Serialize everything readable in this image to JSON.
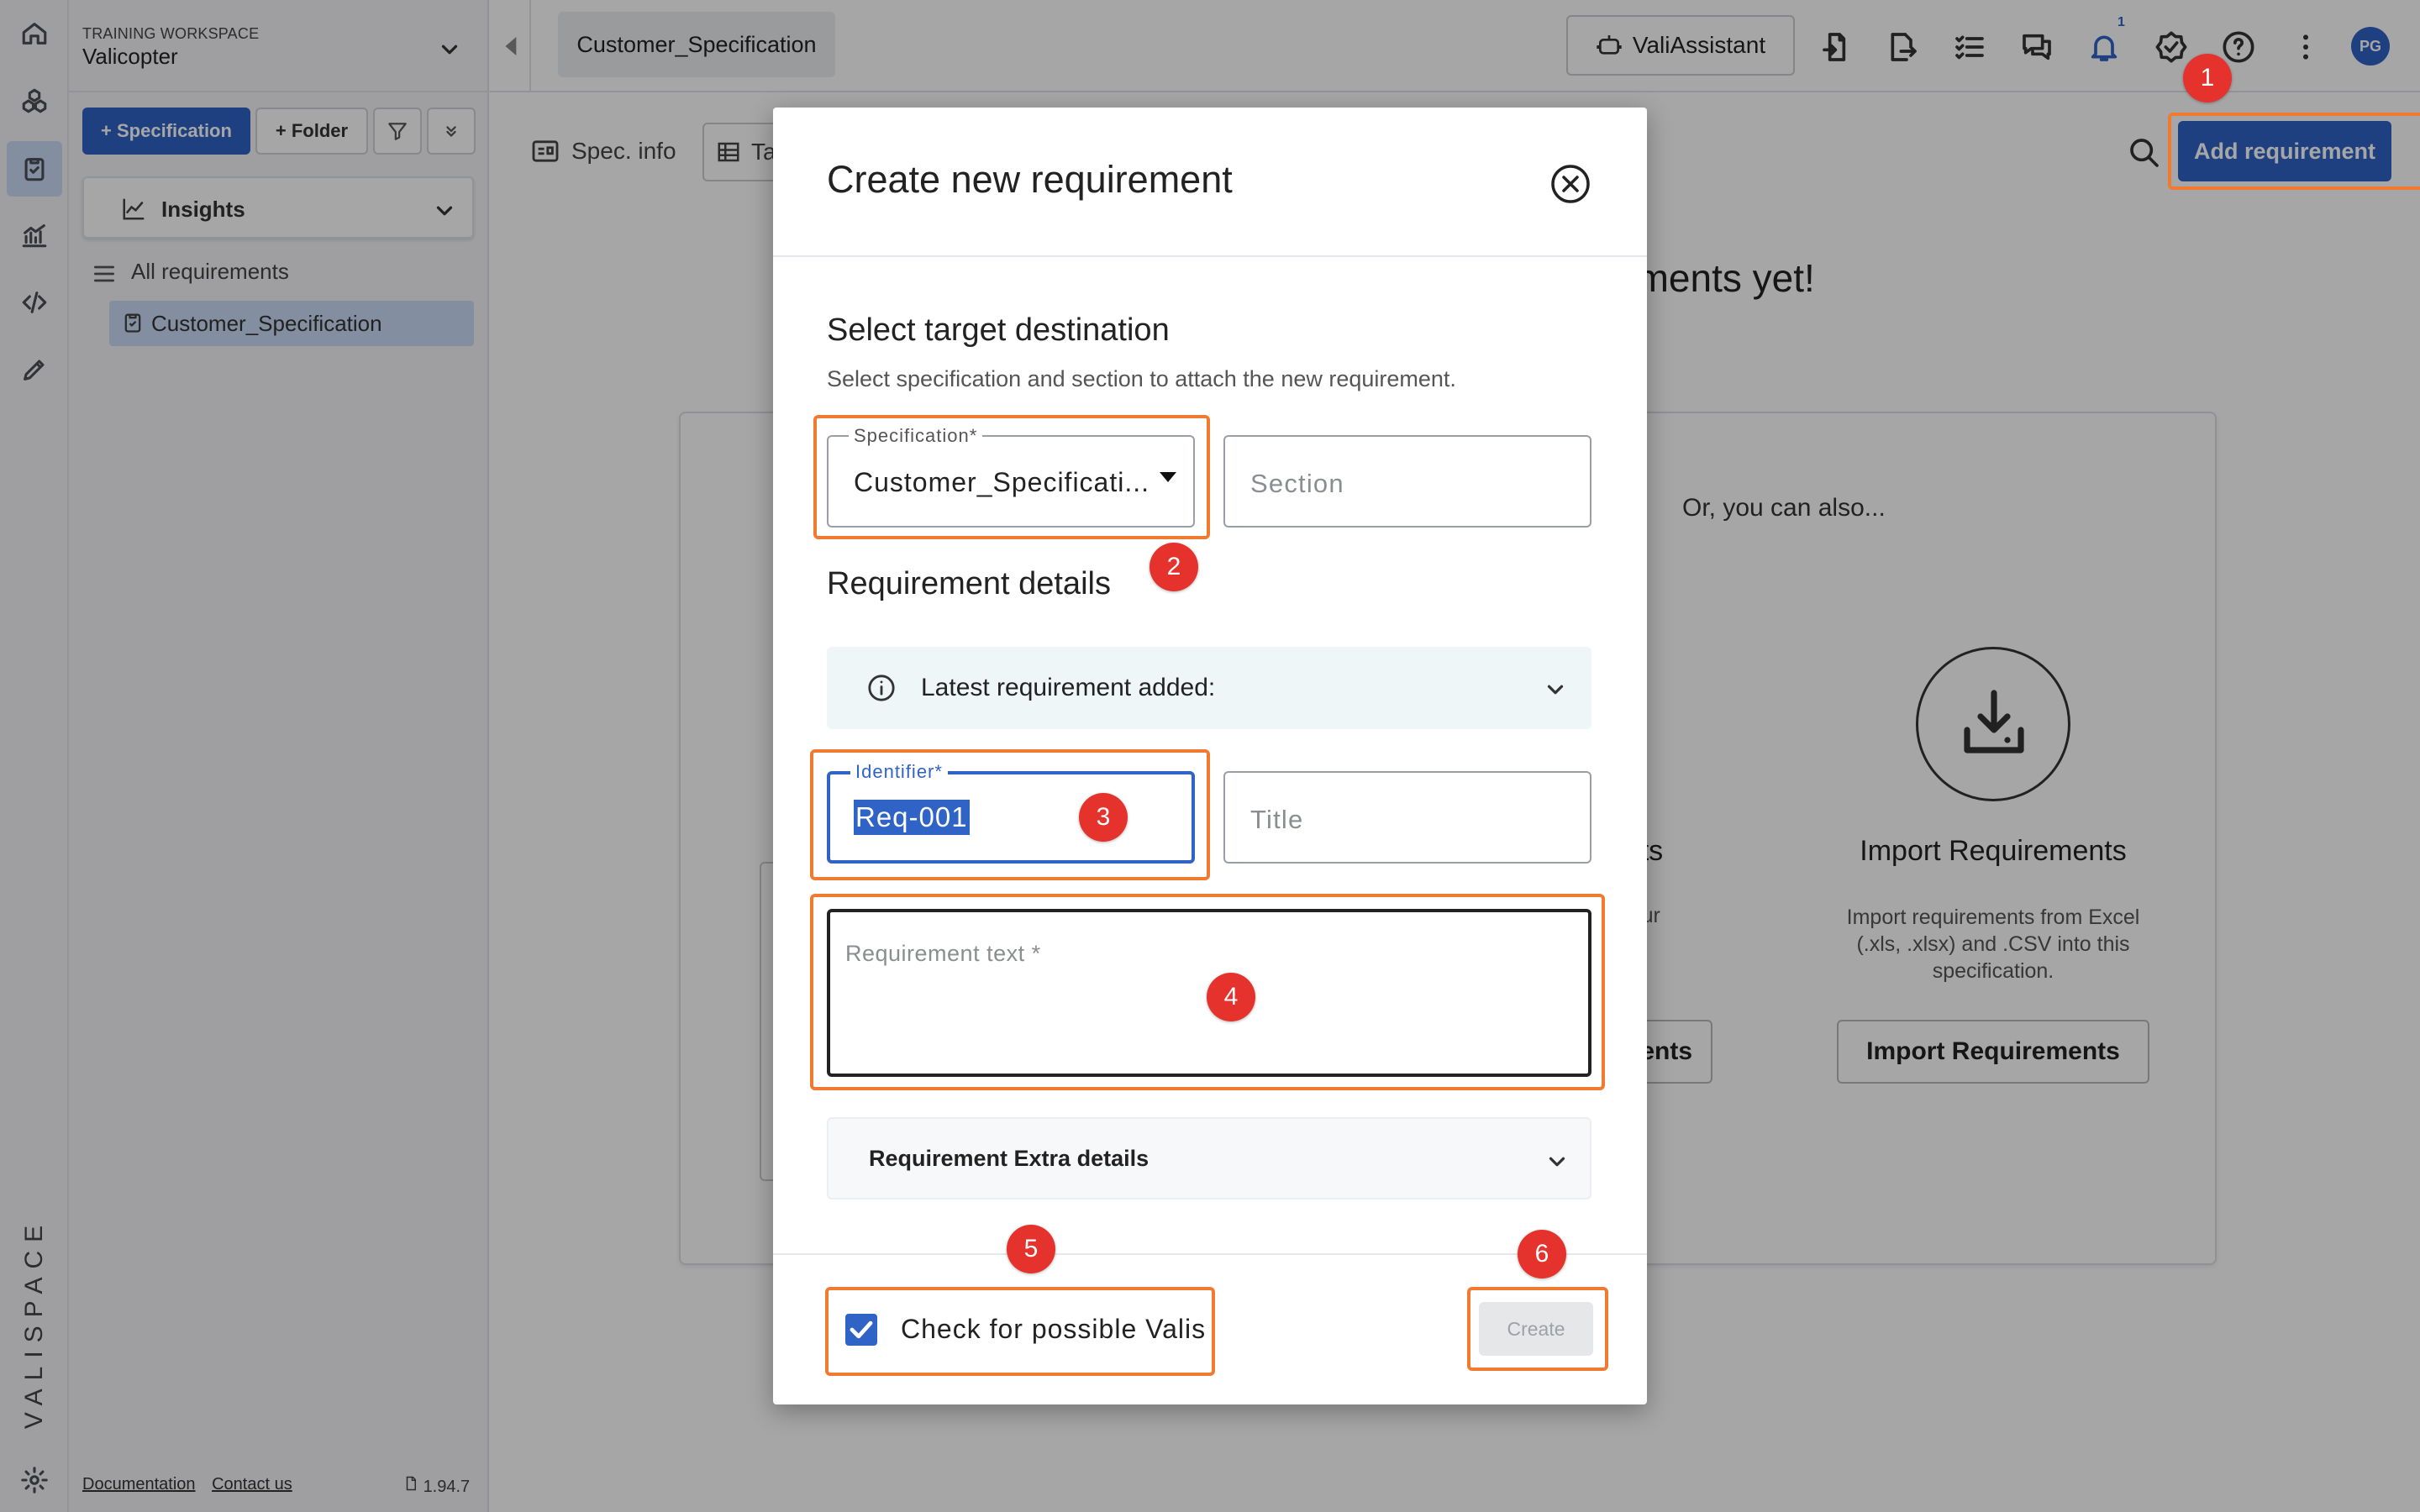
{
  "workspace": {
    "label": "TRAINING WORKSPACE",
    "name": "Valicopter"
  },
  "sidebar": {
    "spec_button": "+ Specification",
    "folder_button": "+ Folder",
    "insights_label": "Insights",
    "all_requirements": "All requirements",
    "tree_item": "Customer_Specification",
    "footer": {
      "documentation": "Documentation",
      "contact": "Contact us",
      "version": "1.94.7"
    },
    "brand": "VALISPACE"
  },
  "topbar": {
    "tab_title": "Customer_Specification",
    "assistant_label": "ValiAssistant",
    "notification_count": "1",
    "avatar_initials": "PG"
  },
  "main": {
    "spec_info_label": "Spec. info",
    "table_tab_label": "Ta",
    "add_requirement": "Add requirement",
    "empty_title": "ements yet!",
    "or_also": "Or, you can also...",
    "import": {
      "title": "Import Requirements",
      "description": "Import requirements from Excel (.xls, .xlsx) and .CSV into this specification.",
      "button": "Import Requirements"
    },
    "left_card": {
      "title": "nents",
      "desc": "or your",
      "button": "ents"
    }
  },
  "modal": {
    "title": "Create new requirement",
    "target_heading": "Select target destination",
    "target_sub": "Select specification and section to attach the new requirement.",
    "spec_field": {
      "legend": "Specification*",
      "value": "Customer_Specificati..."
    },
    "section_field": {
      "placeholder": "Section"
    },
    "details_heading": "Requirement details",
    "latest_label": "Latest requirement added:",
    "identifier_field": {
      "legend": "Identifier*",
      "value": "Req-001"
    },
    "title_field": {
      "placeholder": "Title"
    },
    "text_field": {
      "placeholder": "Requirement text *"
    },
    "extra_label": "Requirement Extra details",
    "checkbox_label": "Check for possible Valis",
    "checkbox_checked": true,
    "create_button": "Create"
  },
  "annotations": {
    "badges": [
      "1",
      "2",
      "3",
      "4",
      "5",
      "6"
    ],
    "highlight_color": "#f07a30",
    "badge_color": "#e5322d"
  },
  "colors": {
    "accent": "#2f63c6",
    "selected_bg": "#c9dcf6"
  },
  "icons": {
    "rail": [
      "home-icon",
      "components-icon",
      "requirements-icon",
      "analytics-icon",
      "code-icon",
      "pencil-icon",
      "settings-icon"
    ],
    "topbar": [
      "import-icon",
      "export-icon",
      "checklist-icon",
      "chat-icon",
      "bell-icon",
      "verified-icon",
      "help-icon",
      "more-vertical-icon"
    ]
  }
}
